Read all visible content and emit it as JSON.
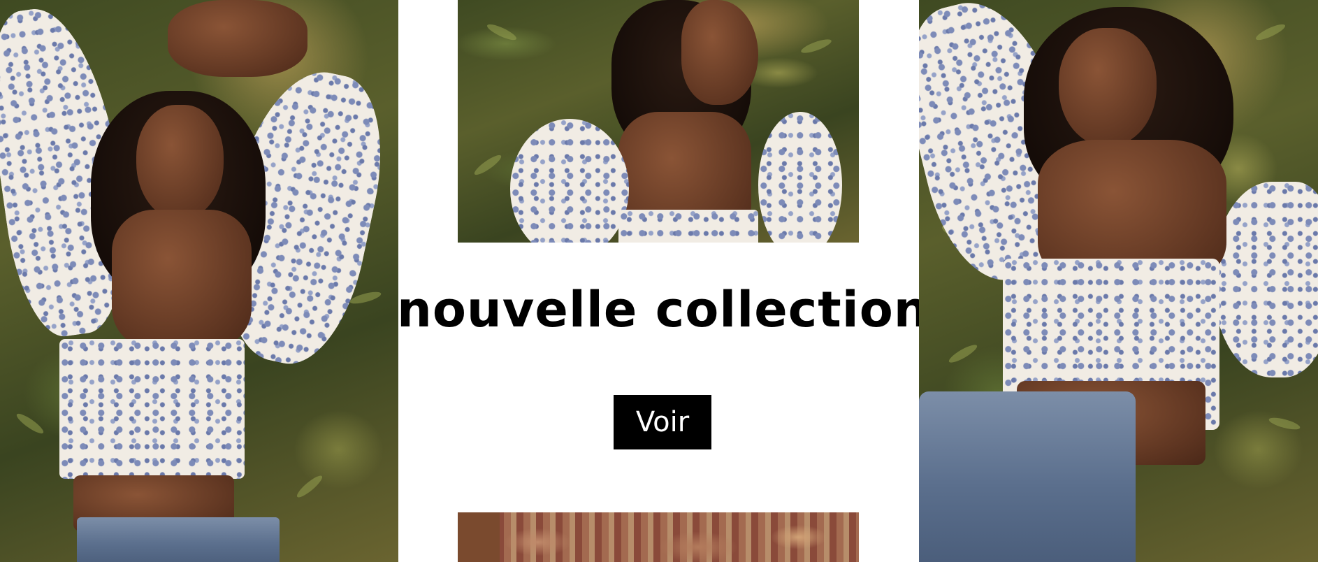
{
  "banner": {
    "headline": "nouvelle collection",
    "cta_label": "Voir"
  },
  "colors": {
    "background": "#ffffff",
    "headline": "#000000",
    "cta_background": "#000000",
    "cta_text": "#ffffff"
  },
  "images": [
    "photo-left-woman-floral-blouse-arms-raised",
    "photo-center-top-woman-profile-floral-blouse",
    "photo-right-woman-floral-blouse-eyes-closed",
    "photo-center-bottom-rug-detail"
  ]
}
